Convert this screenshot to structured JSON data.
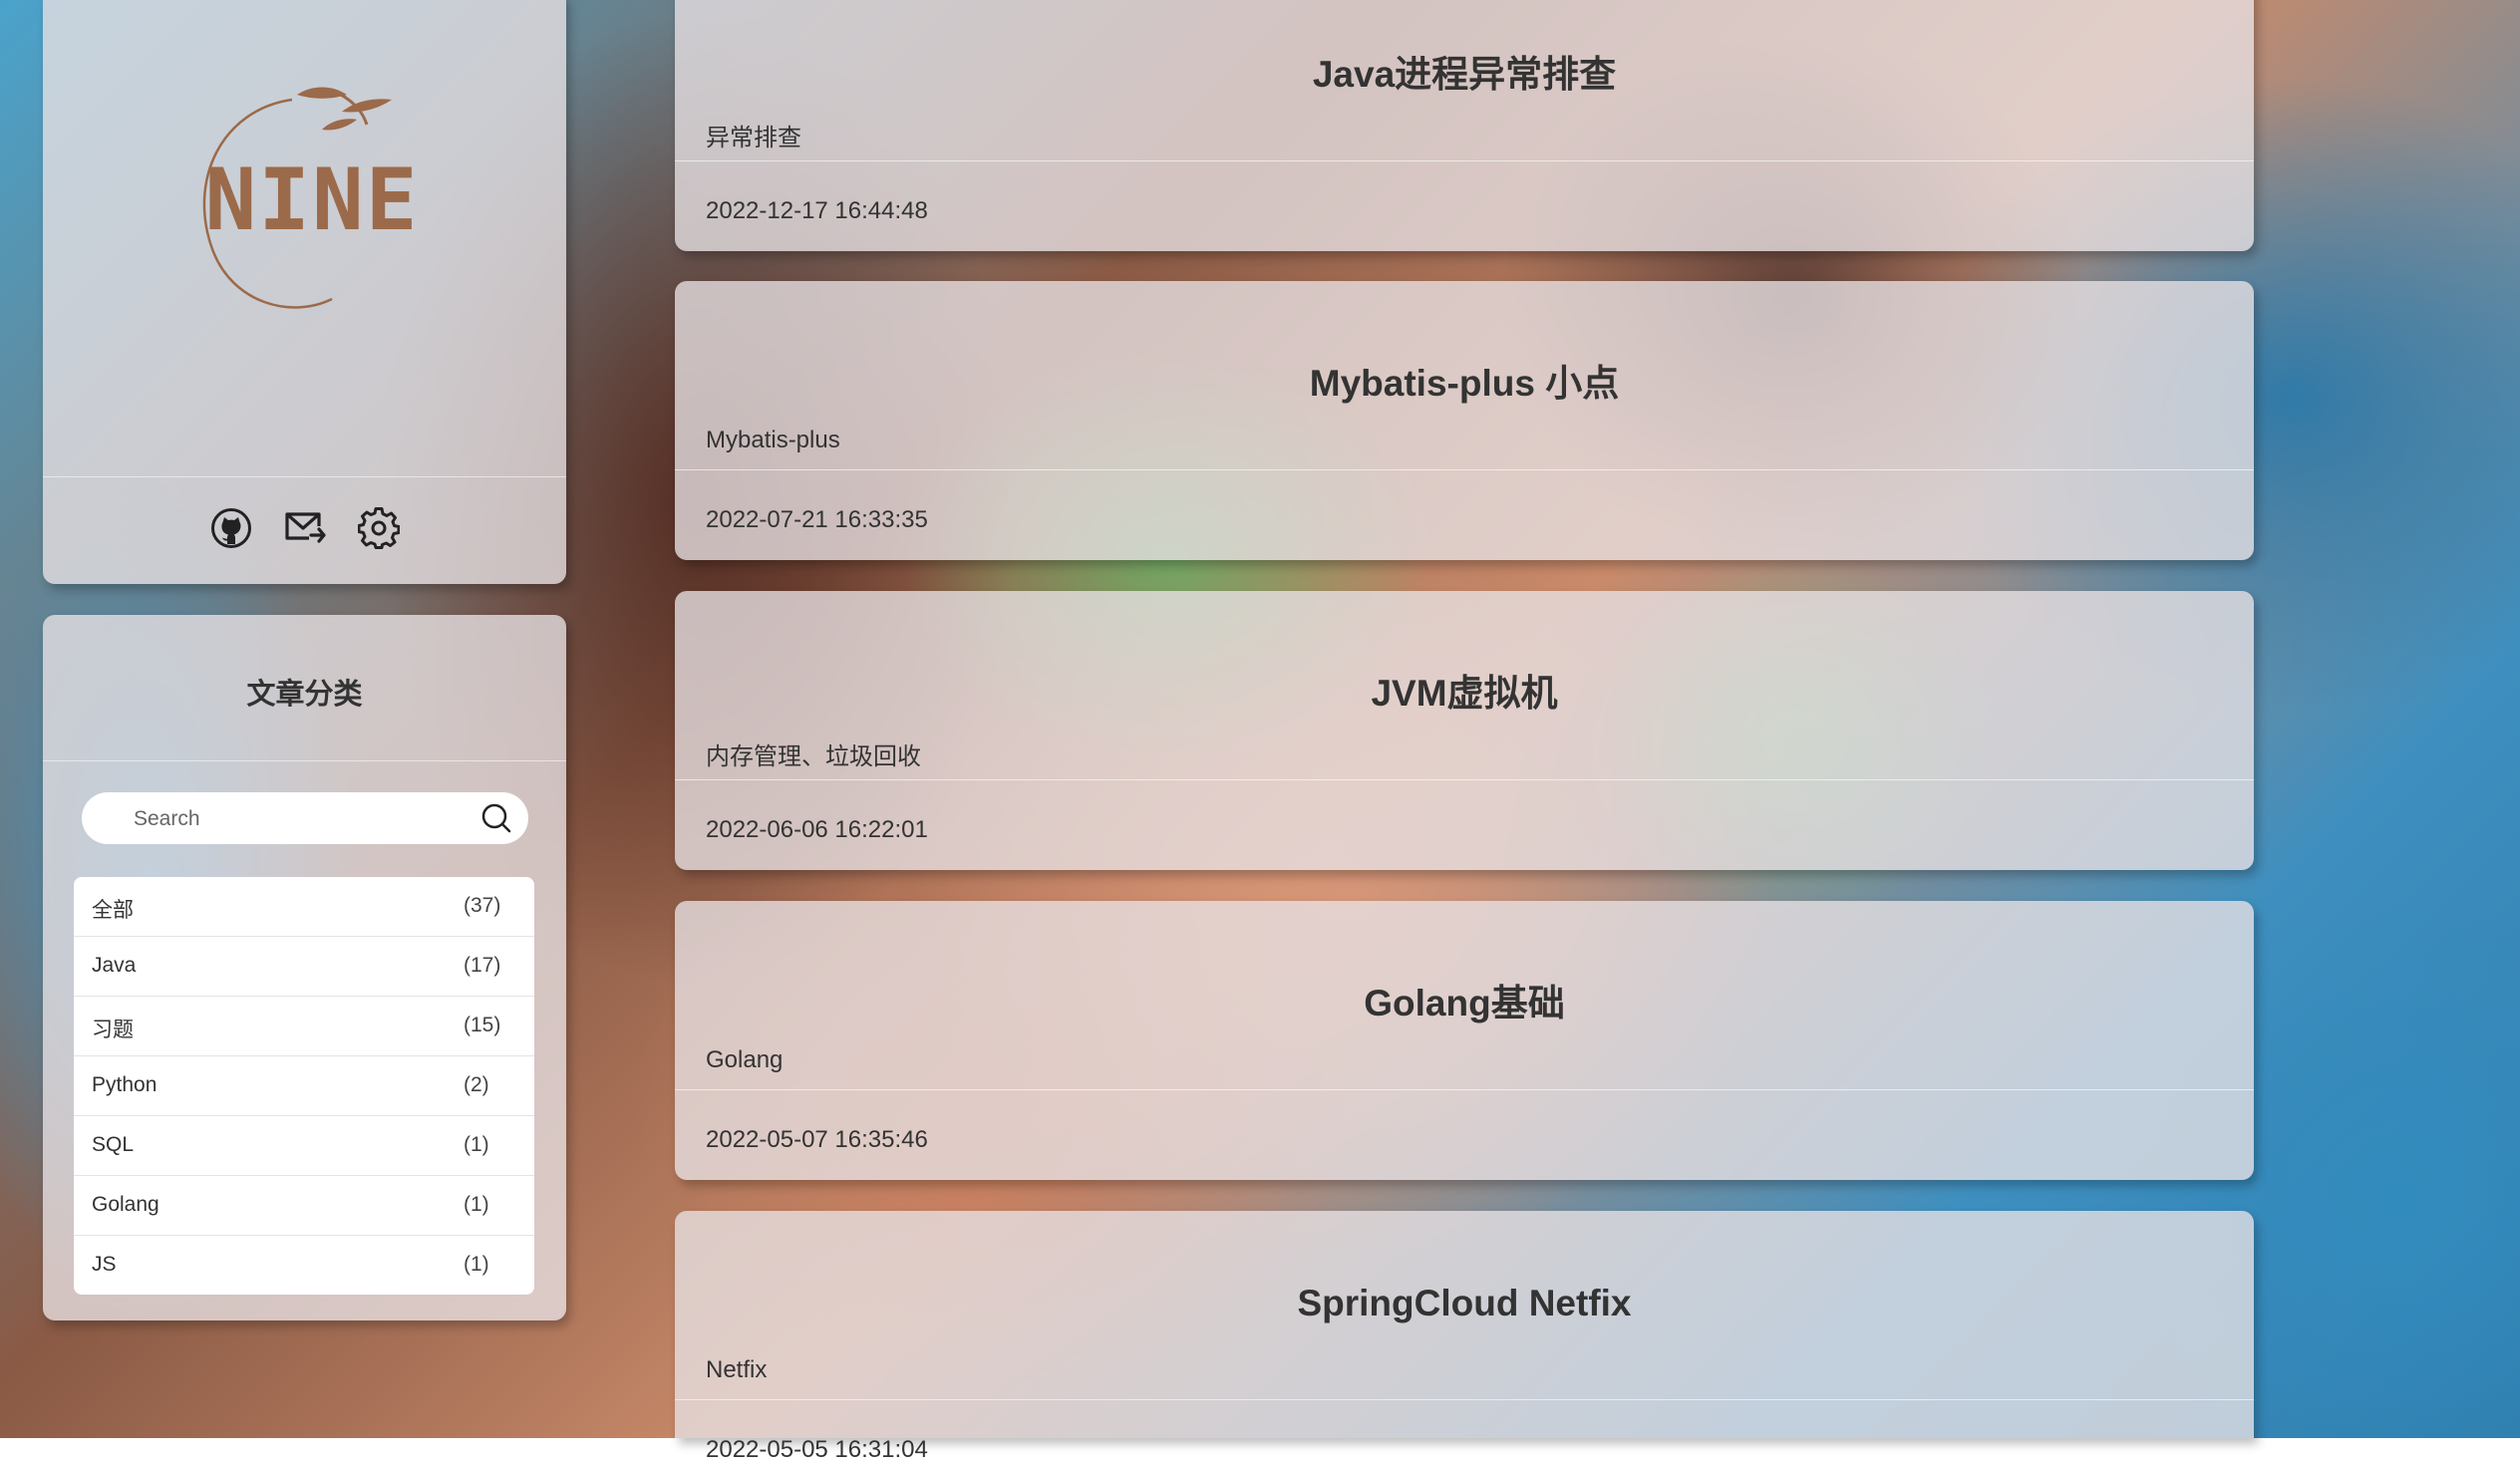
{
  "profile": {
    "logo_text": "NINE",
    "links": [
      {
        "icon": "github-icon"
      },
      {
        "icon": "mail-icon"
      },
      {
        "icon": "gear-icon"
      }
    ]
  },
  "categories": {
    "title": "文章分类",
    "search_placeholder": "Search",
    "items": [
      {
        "name": "全部",
        "count": "(37)"
      },
      {
        "name": "Java",
        "count": "(17)"
      },
      {
        "name": "习题",
        "count": "(15)"
      },
      {
        "name": "Python",
        "count": "(2)"
      },
      {
        "name": "SQL",
        "count": "(1)"
      },
      {
        "name": "Golang",
        "count": "(1)"
      },
      {
        "name": "JS",
        "count": "(1)"
      }
    ]
  },
  "articles": [
    {
      "title": "Java进程异常排查",
      "description": "异常排查",
      "date": "2022-12-17 16:44:48"
    },
    {
      "title": "Mybatis-plus 小点",
      "description": "Mybatis-plus",
      "date": "2022-07-21 16:33:35"
    },
    {
      "title": "JVM虚拟机",
      "description": "内存管理、垃圾回收",
      "date": "2022-06-06 16:22:01"
    },
    {
      "title": "Golang基础",
      "description": "Golang",
      "date": "2022-05-07 16:35:46"
    },
    {
      "title": "SpringCloud Netfix",
      "description": "Netfix",
      "date": "2022-05-05 16:31:04"
    }
  ],
  "colors": {
    "logo": "#9b6a4a",
    "card": "#e8e2e4",
    "text": "#333333"
  }
}
